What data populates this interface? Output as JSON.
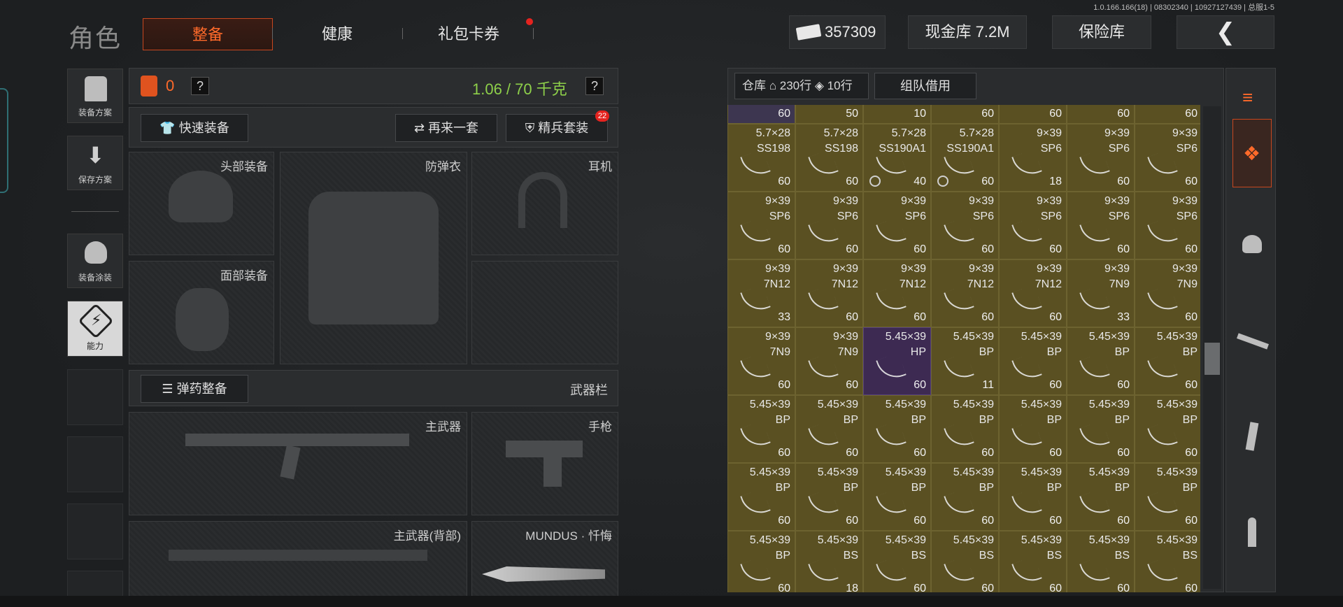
{
  "version": "1.0.166.166(18) | 08302340 | 10927127439 | 总服1-5",
  "title": "角色",
  "tabs": [
    "整备",
    "健康",
    "礼包卡券"
  ],
  "currency": {
    "amount": "357309",
    "cash_vault": "现金库 7.2M",
    "safe": "保险库"
  },
  "left_nav": [
    {
      "label": "装备方案",
      "icon": "vest-icon"
    },
    {
      "label": "保存方案",
      "icon": "download-icon"
    },
    {
      "label": "装备涂装",
      "icon": "helmet-icon"
    },
    {
      "label": "能力",
      "icon": "lightning-icon"
    }
  ],
  "equip": {
    "armor_count": "0",
    "weight": "1.06 / 70 千克",
    "help": "?",
    "quick_equip": "快速装备",
    "again": "再来一套",
    "elite": "精兵套装",
    "elite_badge": "22",
    "slots": {
      "head": "头部装备",
      "vest": "防弹衣",
      "headset": "耳机",
      "face": "面部装备",
      "ammo_btn": "弹药整备",
      "weapon_bar": "武器栏",
      "primary": "主武器",
      "pistol": "手枪",
      "primary_back": "主武器(背部)",
      "melee": "MUNDUS · 忏悔"
    }
  },
  "inventory": {
    "label": "仓库",
    "rows": "230行",
    "rows2": "10行",
    "team_borrow": "组队借用",
    "top_row": [
      "60",
      "50",
      "10",
      "60",
      "60",
      "60",
      "60"
    ],
    "cells": [
      [
        {
          "c": "5.7×28",
          "t": "SS198",
          "q": "60"
        },
        {
          "c": "5.7×28",
          "t": "SS198",
          "q": "60"
        },
        {
          "c": "5.7×28",
          "t": "SS190A1",
          "q": "40",
          "b": true
        },
        {
          "c": "5.7×28",
          "t": "SS190A1",
          "q": "60",
          "b": true
        },
        {
          "c": "9×39",
          "t": "SP6",
          "q": "18"
        },
        {
          "c": "9×39",
          "t": "SP6",
          "q": "60"
        },
        {
          "c": "9×39",
          "t": "SP6",
          "q": "60"
        }
      ],
      [
        {
          "c": "9×39",
          "t": "SP6",
          "q": "60"
        },
        {
          "c": "9×39",
          "t": "SP6",
          "q": "60"
        },
        {
          "c": "9×39",
          "t": "SP6",
          "q": "60"
        },
        {
          "c": "9×39",
          "t": "SP6",
          "q": "60"
        },
        {
          "c": "9×39",
          "t": "SP6",
          "q": "60"
        },
        {
          "c": "9×39",
          "t": "SP6",
          "q": "60"
        },
        {
          "c": "9×39",
          "t": "SP6",
          "q": "60"
        }
      ],
      [
        {
          "c": "9×39",
          "t": "7N12",
          "q": "33"
        },
        {
          "c": "9×39",
          "t": "7N12",
          "q": "60"
        },
        {
          "c": "9×39",
          "t": "7N12",
          "q": "60"
        },
        {
          "c": "9×39",
          "t": "7N12",
          "q": "60"
        },
        {
          "c": "9×39",
          "t": "7N12",
          "q": "60"
        },
        {
          "c": "9×39",
          "t": "7N9",
          "q": "33"
        },
        {
          "c": "9×39",
          "t": "7N9",
          "q": "60"
        }
      ],
      [
        {
          "c": "9×39",
          "t": "7N9",
          "q": "60"
        },
        {
          "c": "9×39",
          "t": "7N9",
          "q": "60"
        },
        {
          "c": "5.45×39",
          "t": "HP",
          "q": "60",
          "hp": true
        },
        {
          "c": "5.45×39",
          "t": "BP",
          "q": "11"
        },
        {
          "c": "5.45×39",
          "t": "BP",
          "q": "60"
        },
        {
          "c": "5.45×39",
          "t": "BP",
          "q": "60"
        },
        {
          "c": "5.45×39",
          "t": "BP",
          "q": "60"
        }
      ],
      [
        {
          "c": "5.45×39",
          "t": "BP",
          "q": "60"
        },
        {
          "c": "5.45×39",
          "t": "BP",
          "q": "60"
        },
        {
          "c": "5.45×39",
          "t": "BP",
          "q": "60"
        },
        {
          "c": "5.45×39",
          "t": "BP",
          "q": "60"
        },
        {
          "c": "5.45×39",
          "t": "BP",
          "q": "60"
        },
        {
          "c": "5.45×39",
          "t": "BP",
          "q": "60"
        },
        {
          "c": "5.45×39",
          "t": "BP",
          "q": "60"
        }
      ],
      [
        {
          "c": "5.45×39",
          "t": "BP",
          "q": "60"
        },
        {
          "c": "5.45×39",
          "t": "BP",
          "q": "60"
        },
        {
          "c": "5.45×39",
          "t": "BP",
          "q": "60"
        },
        {
          "c": "5.45×39",
          "t": "BP",
          "q": "60"
        },
        {
          "c": "5.45×39",
          "t": "BP",
          "q": "60"
        },
        {
          "c": "5.45×39",
          "t": "BP",
          "q": "60"
        },
        {
          "c": "5.45×39",
          "t": "BP",
          "q": "60"
        }
      ],
      [
        {
          "c": "5.45×39",
          "t": "BP",
          "q": "60"
        },
        {
          "c": "5.45×39",
          "t": "BS",
          "q": "18"
        },
        {
          "c": "5.45×39",
          "t": "BS",
          "q": "60"
        },
        {
          "c": "5.45×39",
          "t": "BS",
          "q": "60"
        },
        {
          "c": "5.45×39",
          "t": "BS",
          "q": "60"
        },
        {
          "c": "5.45×39",
          "t": "BS",
          "q": "60"
        },
        {
          "c": "5.45×39",
          "t": "BS",
          "q": "60"
        }
      ]
    ]
  },
  "colors": {
    "accent": "#ff6a2a",
    "weight_green": "#8ed04a",
    "ammo_cell": "#5a5022",
    "hp_cell": "#3d2a52"
  }
}
